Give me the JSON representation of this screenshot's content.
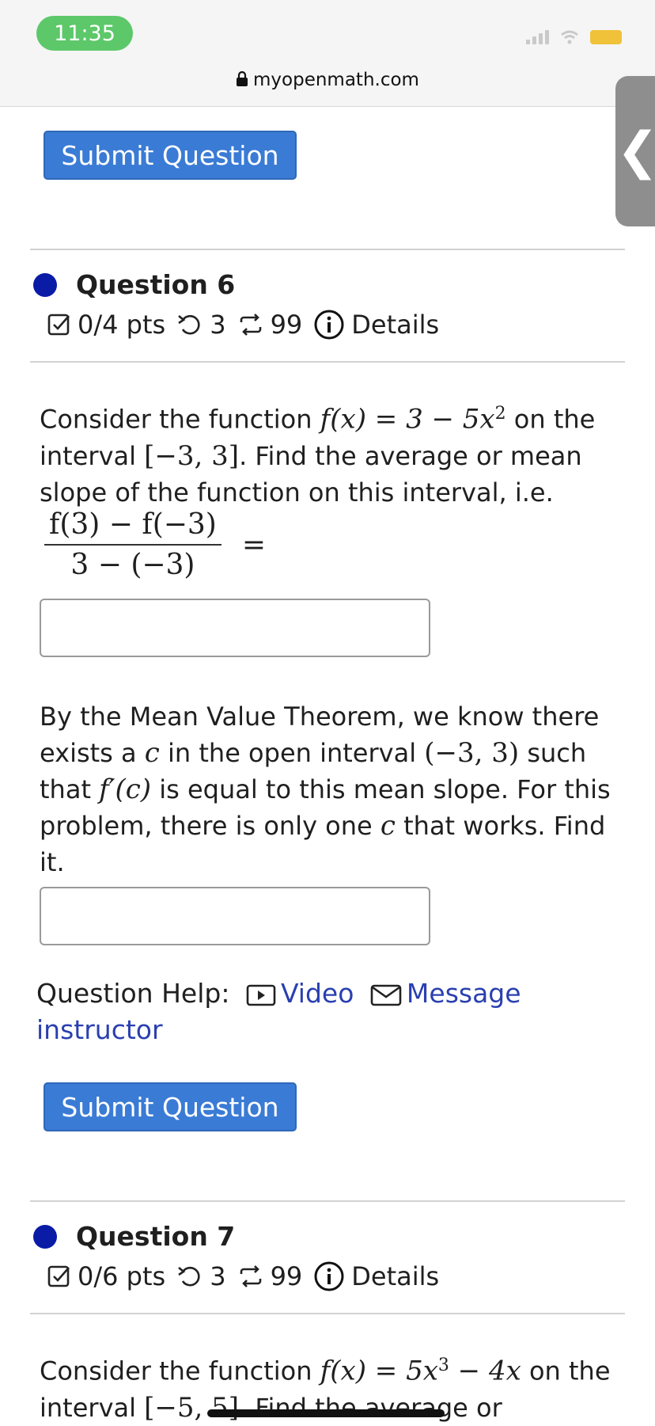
{
  "status": {
    "time": "11:35",
    "url": "myopenmath.com",
    "side_tab_glyph": "❮"
  },
  "buttons": {
    "submit_top": "Submit Question",
    "submit_bottom": "Submit Question"
  },
  "q6": {
    "title": "Question 6",
    "pts": "0/4 pts",
    "retries": "3",
    "attempts": "99",
    "details": "Details",
    "p1_a": "Consider the function ",
    "p1_fx": "f(x) = 3 − 5x",
    "p1_exp": "2",
    "p1_b": " on the interval ",
    "p1_int": "[−3, 3]",
    "p1_c": ". Find the average or mean slope of the function on this interval, i.e.",
    "frac_num": "f(3) − f(−3)",
    "frac_den": "3 − (−3)",
    "frac_eq": "=",
    "p2_a": "By the Mean Value Theorem, we know there exists a ",
    "p2_c1": "c",
    "p2_b": " in the open interval ",
    "p2_int": "(−3, 3)",
    "p2_c": " such that ",
    "p2_fc": "f′(c)",
    "p2_d": " is equal to this mean slope. For this problem, there is only one ",
    "p2_c2": "c",
    "p2_e": " that works. Find it."
  },
  "help": {
    "label": "Question Help:",
    "video": "Video",
    "message": "Message instructor"
  },
  "q7": {
    "title": "Question 7",
    "pts": "0/6 pts",
    "retries": "3",
    "attempts": "99",
    "details": "Details",
    "p1_a": "Consider the function ",
    "p1_fx": "f(x) = 5x",
    "p1_exp": "3",
    "p1_b": " − 4x",
    "p1_c": " on the interval ",
    "p1_int": "[−5, 5]",
    "p1_d": ". Find the average or"
  },
  "colors": {
    "button": "#3a7bd5",
    "link": "#2a3fb0",
    "dot": "#0a1ba6",
    "time_pill": "#5dc86a"
  }
}
